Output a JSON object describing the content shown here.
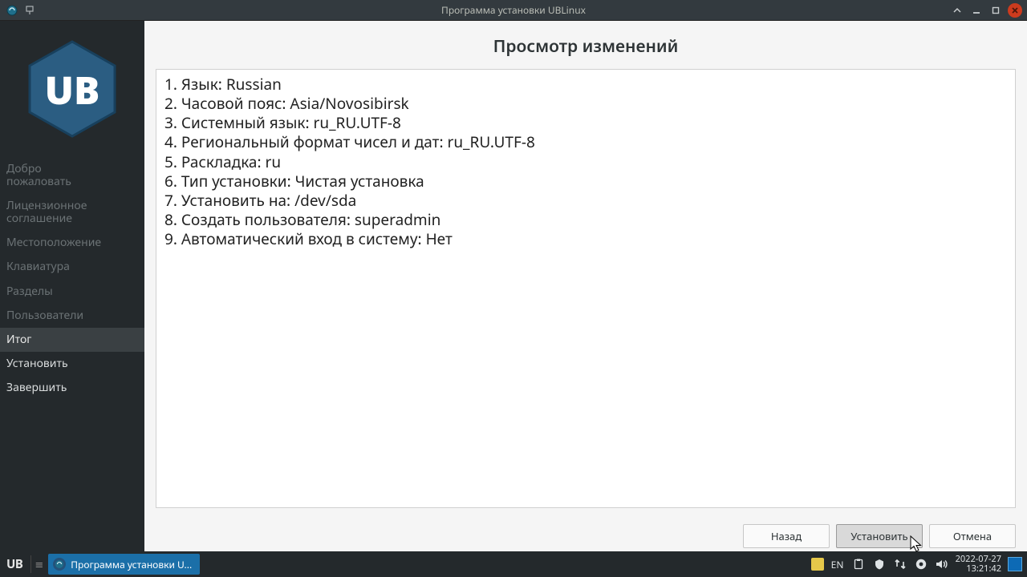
{
  "window": {
    "title": "Программа установки UBLinux"
  },
  "sidebar": {
    "logo_text": "UB",
    "steps": [
      "Добро\nпожаловать",
      "Лицензионное\nсоглашение",
      "Местоположение",
      "Клавиатура",
      "Разделы",
      "Пользователи",
      "Итог",
      "Установить",
      "Завершить"
    ],
    "active_index": 6
  },
  "page": {
    "title": "Просмотр изменений",
    "summary": [
      "1. Язык: Russian",
      "2. Часовой пояс: Asia/Novosibirsk",
      "3. Системный язык: ru_RU.UTF-8",
      "4. Региональный формат чисел и дат: ru_RU.UTF-8",
      "5. Раскладка: ru",
      "6. Тип установки: Чистая установка",
      "7. Установить на: /dev/sda",
      "8. Создать пользователя: superadmin",
      "9. Автоматический вход в систему: Нет"
    ]
  },
  "buttons": {
    "back": "Назад",
    "install": "Установить",
    "cancel": "Отмена"
  },
  "taskbar": {
    "start": "UB",
    "task_label": "Программа установки U...",
    "lang": "EN",
    "date": "2022-07-27",
    "time": "13:21:42"
  }
}
